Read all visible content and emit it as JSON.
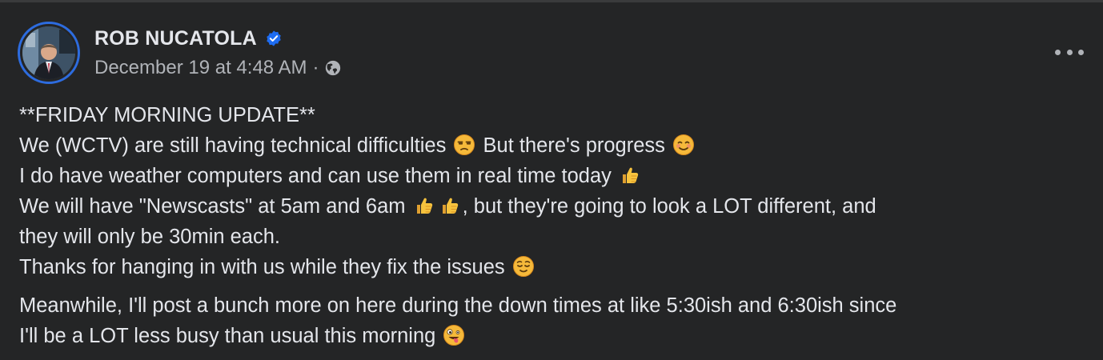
{
  "author": {
    "name": "ROB NUCATOLA",
    "timestamp": "December 19 at 4:48 AM",
    "separator": "·",
    "audience_icon": "globe-icon",
    "verified_icon": "verified-badge-icon"
  },
  "colors": {
    "background": "#242526",
    "text": "#e4e6eb",
    "secondary_text": "#b0b3b8",
    "verified_blue": "#1d6cf2",
    "avatar_ring": "#2d6cdf"
  },
  "menu": {
    "icon": "more-options-icon"
  },
  "post": {
    "line1": "**FRIDAY MORNING UPDATE**",
    "line2a": "We (WCTV) are still having technical difficulties",
    "line2b": "But there's progress",
    "line3": "I do have weather computers and can use them in real time today",
    "line4a": "We will have \"Newscasts\" at 5am and 6am",
    "line4b": ", but they're going to look a LOT different, and",
    "line5": "they will only be 30min each.",
    "line6": "Thanks for hanging in with us while they fix the issues",
    "line7": "Meanwhile, I'll post a bunch more on here during the down times at like 5:30ish and 6:30ish since",
    "line8": "I'll be a LOT less busy than usual this morning"
  },
  "emojis": [
    "unamused-face",
    "smiling-face",
    "thumbs-up",
    "thumbs-up",
    "thumbs-up",
    "relieved-face",
    "zany-face"
  ]
}
